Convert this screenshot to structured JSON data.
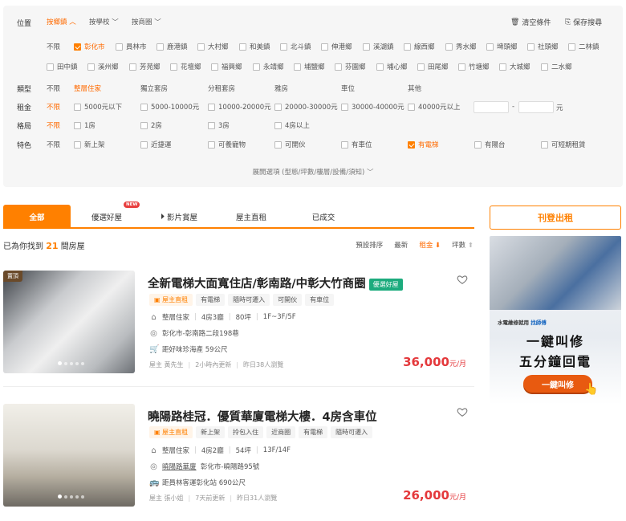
{
  "filters": {
    "location": {
      "label": "位置",
      "modes": [
        "按鄉鎮",
        "按學校",
        "按商圈"
      ],
      "clear_label": "清空條件",
      "save_label": "保存搜尋",
      "row1": [
        "不限",
        "彰化市",
        "員林市",
        "鹿港鎮",
        "大村鄉",
        "和美鎮",
        "北斗鎮",
        "伸港鄉",
        "溪湖鎮",
        "線西鄉",
        "秀水鄉",
        "埤頭鄉",
        "社頭鄉",
        "二林鎮"
      ],
      "row2": [
        "田中鎮",
        "溪州鄉",
        "芳苑鄉",
        "花壇鄉",
        "福興鄉",
        "永靖鄉",
        "埔鹽鄉",
        "芬園鄉",
        "埔心鄉",
        "田尾鄉",
        "竹塘鄉",
        "大城鄉",
        "二水鄉"
      ]
    },
    "type": {
      "label": "類型",
      "options": [
        "不限",
        "整層住家",
        "獨立套房",
        "分租套房",
        "雅房",
        "車位",
        "其他"
      ]
    },
    "rent": {
      "label": "租金",
      "options": [
        "不限",
        "5000元以下",
        "5000-10000元",
        "10000-20000元",
        "20000-30000元",
        "30000-40000元",
        "40000元以上"
      ],
      "dash": "-",
      "unit": "元"
    },
    "layout": {
      "label": "格局",
      "options": [
        "不限",
        "1房",
        "2房",
        "3房",
        "4房以上"
      ]
    },
    "features": {
      "label": "特色",
      "options": [
        "不限",
        "新上架",
        "近捷運",
        "可養寵物",
        "可開伙",
        "有車位",
        "有電梯",
        "有陽台",
        "可短期租賃"
      ]
    },
    "expand": "展開選項 (型態/坪數/樓層/設備/須知)"
  },
  "tabs": [
    "全部",
    "優選好屋",
    "影片賞屋",
    "屋主直租",
    "已成交"
  ],
  "new_badge": "NEW",
  "results": {
    "prefix": "已為你找到",
    "count": "21",
    "suffix": "間房屋"
  },
  "sorts": [
    "預設排序",
    "最新",
    "租金",
    "坪數"
  ],
  "listings": [
    {
      "pin": "置頂",
      "title": "全新電梯大面寬住店/彰南路/中彰大竹商圈",
      "badge": "優選好屋",
      "tags": [
        "屋主直租",
        "有電梯",
        "隨時可遷入",
        "可開伙",
        "有車位"
      ],
      "kind": "整層住家",
      "rooms": "4房3廳",
      "size": "80坪",
      "floor": "1F~3F/5F",
      "address": "彰化市-彰南路二段198巷",
      "nearby": "距好味珍海產 59公尺",
      "poster": "屋主 黃先生",
      "updated": "2小時內更新",
      "views": "昨日38人瀏覽",
      "price": "36,000",
      "price_unit": "元/月"
    },
    {
      "title": "曉陽路桂冠．優質華廈電梯大樓．4房含車位",
      "tags": [
        "屋主直租",
        "新上架",
        "拎包入住",
        "近商圈",
        "有電梯",
        "隨時可遷入"
      ],
      "kind": "整層住家",
      "rooms": "4房2廳",
      "size": "54坪",
      "floor": "13F/14F",
      "community": "曉陽路華廈",
      "address": "彰化市-曉陽路95號",
      "nearby": "距員林客運彰化站 690公尺",
      "poster": "屋主 張小姐",
      "updated": "7天前更新",
      "views": "昨日31人瀏覽",
      "price": "26,000",
      "price_unit": "元/月"
    }
  ],
  "sidebar": {
    "post_label": "刊登出租",
    "ad": {
      "small_pre": "水電維修就用",
      "small_brand": "找師傅",
      "line1": "一鍵叫修",
      "line2": "五分鐘回電",
      "button": "一鍵叫修"
    }
  },
  "colors": {
    "accent": "#ff8000",
    "price": "#e4393c",
    "badge_green": "#1cab7d"
  }
}
